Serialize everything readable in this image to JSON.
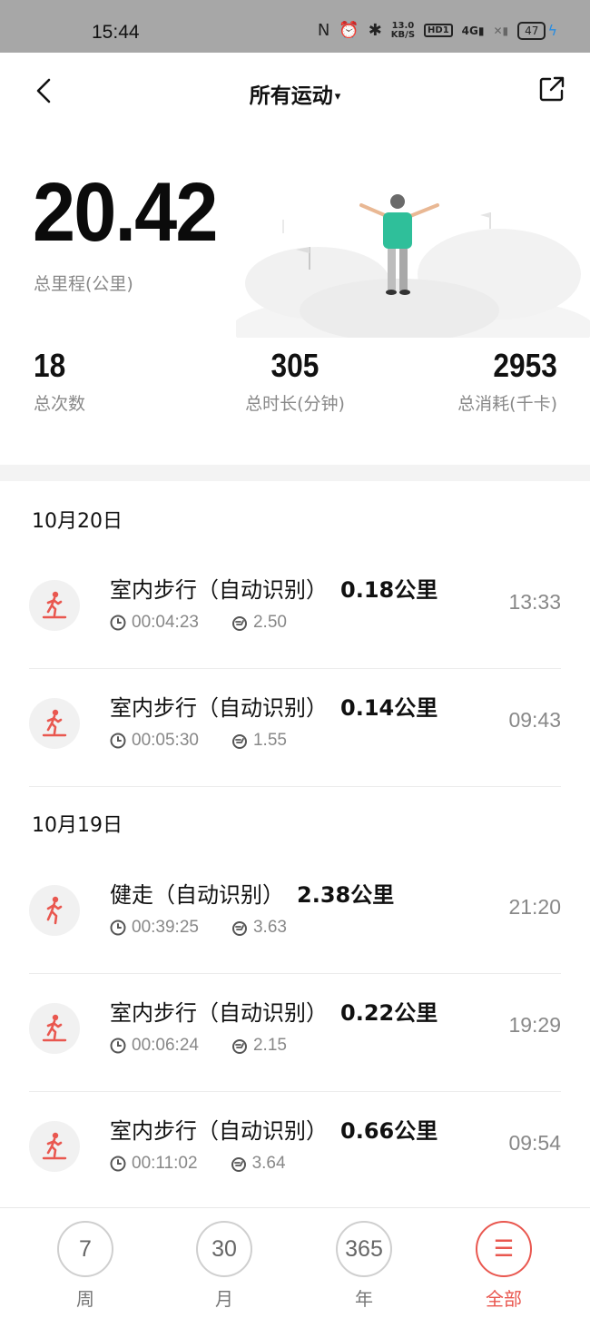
{
  "status_bar": {
    "time": "15:44",
    "net_speed_value": "13.0",
    "net_speed_unit": "KB/S",
    "hd_badge": "HD1",
    "signal_label": "4G",
    "battery": "47"
  },
  "nav": {
    "title": "所有运动",
    "caret": "▾"
  },
  "summary": {
    "total_distance": "20.42",
    "total_distance_label": "总里程(公里)",
    "count_value": "18",
    "count_label": "总次数",
    "duration_value": "305",
    "duration_label": "总时长(分钟)",
    "calories_value": "2953",
    "calories_label": "总消耗(千卡)"
  },
  "groups": [
    {
      "date": "10月20日",
      "entries": [
        {
          "name": "室内步行（自动识别）",
          "distance": "0.18公里",
          "duration": "00:04:23",
          "pace": "2.50",
          "time": "13:33",
          "icon": "treadmill-walk-icon"
        },
        {
          "name": "室内步行（自动识别）",
          "distance": "0.14公里",
          "duration": "00:05:30",
          "pace": "1.55",
          "time": "09:43",
          "icon": "treadmill-walk-icon"
        }
      ]
    },
    {
      "date": "10月19日",
      "entries": [
        {
          "name": "健走（自动识别）",
          "distance": "2.38公里",
          "duration": "00:39:25",
          "pace": "3.63",
          "time": "21:20",
          "icon": "walk-icon"
        },
        {
          "name": "室内步行（自动识别）",
          "distance": "0.22公里",
          "duration": "00:06:24",
          "pace": "2.15",
          "time": "19:29",
          "icon": "treadmill-walk-icon"
        },
        {
          "name": "室内步行（自动识别）",
          "distance": "0.66公里",
          "duration": "00:11:02",
          "pace": "3.64",
          "time": "09:54",
          "icon": "treadmill-walk-icon"
        }
      ]
    }
  ],
  "tabs": [
    {
      "value": "7",
      "label": "周"
    },
    {
      "value": "30",
      "label": "月"
    },
    {
      "value": "365",
      "label": "年"
    },
    {
      "value": "☰",
      "label": "全部",
      "active": true
    }
  ],
  "colors": {
    "accent": "#e9574f",
    "status_bar_bg": "#a7a7a7",
    "figure_shirt": "#2fbf9a"
  }
}
